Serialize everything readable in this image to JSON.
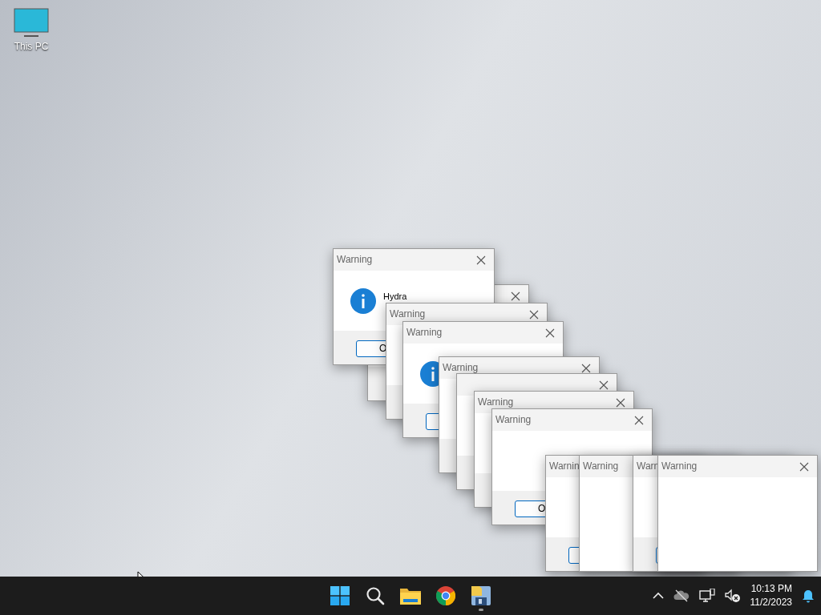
{
  "desktop": {
    "icons": [
      {
        "label": "This PC"
      }
    ]
  },
  "windows": [
    {
      "kind": "message"
    },
    {
      "kind": "message",
      "title": "Warning",
      "message": "Hydra",
      "button": "O"
    },
    {
      "kind": "message",
      "title": "Warning"
    },
    {
      "kind": "message",
      "title": "Warning"
    },
    {
      "kind": "message",
      "title": "Warning"
    },
    {
      "kind": "message"
    },
    {
      "kind": "message",
      "title": "Warning"
    },
    {
      "kind": "loading",
      "title": "Warning",
      "button": "O"
    },
    {
      "kind": "loading",
      "title": "Warnin"
    },
    {
      "kind": "blank",
      "title": "Warning"
    },
    {
      "kind": "loading",
      "title": "Warn"
    },
    {
      "kind": "blank",
      "title": "Warning"
    }
  ],
  "taskbar": {
    "apps": [
      {
        "kind": "start",
        "running": false
      },
      {
        "kind": "search",
        "running": false
      },
      {
        "kind": "folder",
        "running": false
      },
      {
        "kind": "browser",
        "running": false
      },
      {
        "kind": "disk",
        "running": true
      }
    ],
    "tray": {
      "time": "10:13 PM",
      "date": "11/2/2023"
    }
  }
}
